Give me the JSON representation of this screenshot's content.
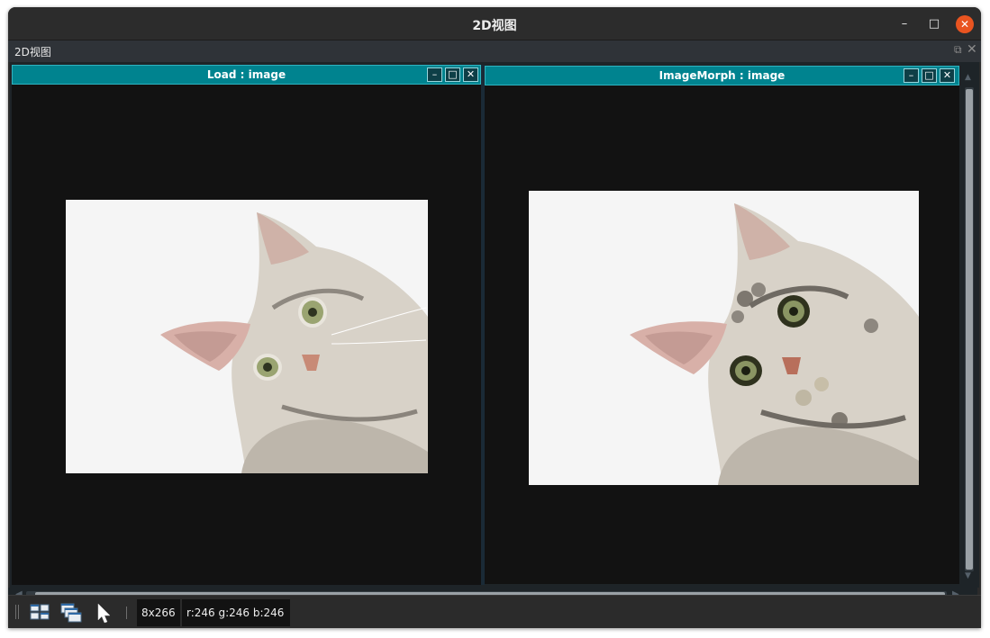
{
  "window": {
    "title": "2D视图"
  },
  "dock": {
    "title": "2D视图"
  },
  "panels": [
    {
      "title": "Load : image"
    },
    {
      "title": "ImageMorph : image"
    }
  ],
  "status": {
    "size": "8x266",
    "rgb": "r:246 g:246 b:246"
  },
  "icons": {
    "window_controls": [
      "minimize-icon",
      "maximize-icon",
      "close-icon"
    ],
    "dock_controls": [
      "float-icon",
      "close-icon"
    ],
    "toolbar": [
      "tile-windows-icon",
      "cascade-windows-icon",
      "pointer-icon"
    ]
  },
  "colors": {
    "panel_header": "#00838f",
    "close_button": "#e95420",
    "canvas_bg": "#121212"
  }
}
